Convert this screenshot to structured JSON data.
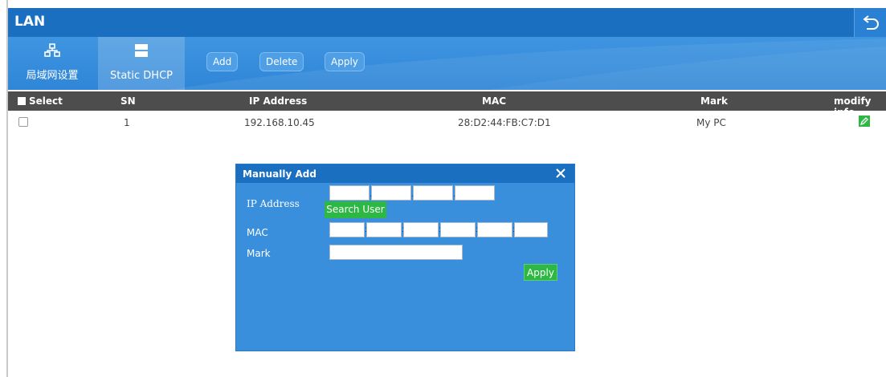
{
  "window": {
    "title": "LAN"
  },
  "icons": {
    "back": "back-arrow-icon",
    "lan": "network-icon",
    "static": "server-icon",
    "edit": "edit-icon",
    "close": "close-icon"
  },
  "toolbar": {
    "tabs": [
      {
        "label": "局域网设置",
        "icon": "network-icon"
      },
      {
        "label": "Static DHCP",
        "icon": "server-icon",
        "active": true
      }
    ],
    "add_label": "Add",
    "delete_label": "Delete",
    "apply_label": "Apply"
  },
  "table": {
    "columns": [
      "Select",
      "SN",
      "IP Address",
      "MAC",
      "Mark",
      "modify info"
    ],
    "rows": [
      {
        "sn": "1",
        "ip": "192.168.10.45",
        "mac": "28:D2:44:FB:C7:D1",
        "mark": "My PC",
        "checked": false
      }
    ]
  },
  "dialog": {
    "title": "Manually Add",
    "ip_label": "IP Address",
    "search_label": "Search User",
    "mac_label": "MAC",
    "mark_label": "Mark",
    "apply_label": "Apply",
    "ip_values": [
      "",
      "",
      "",
      ""
    ],
    "mac_values": [
      "",
      "",
      "",
      "",
      "",
      ""
    ],
    "mark_value": ""
  },
  "colors": {
    "titlebar": "#1a6fc1",
    "toolbar": "#3a8fdc",
    "header": "#4d4d4d",
    "accent_green": "#2db843"
  }
}
